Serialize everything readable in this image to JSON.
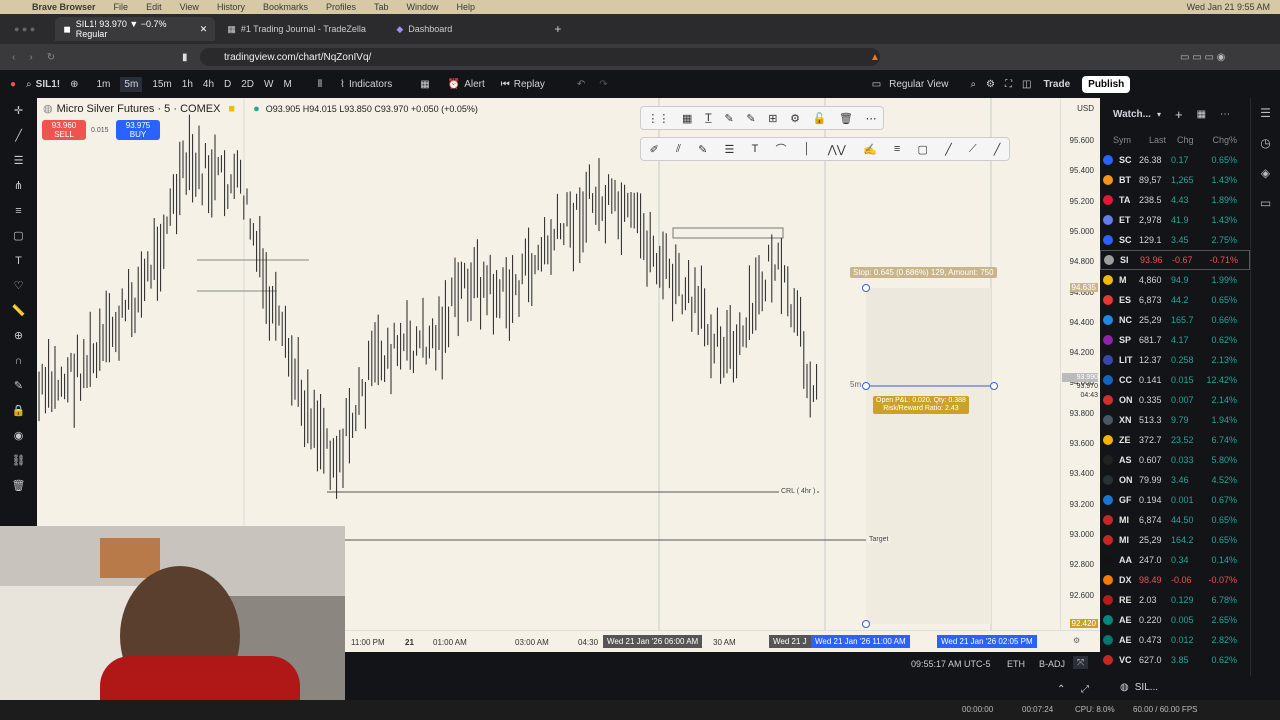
{
  "os_menu": {
    "app": "Brave Browser",
    "items": [
      "File",
      "Edit",
      "View",
      "History",
      "Bookmarks",
      "Profiles",
      "Tab",
      "Window",
      "Help"
    ],
    "clock": "Wed Jan 21  9:55 AM"
  },
  "browser_tabs": [
    {
      "label": "SIL1! 93.970 ▼ −0.7% Regular"
    },
    {
      "label": "#1 Trading Journal - TradeZella"
    },
    {
      "label": "Dashboard"
    }
  ],
  "url": "tradingview.com/chart/NqZonIVq/",
  "toolbar": {
    "symbol": "SIL1!",
    "intervals": [
      "1m",
      "5m",
      "15m",
      "1h",
      "4h",
      "D",
      "2D",
      "W",
      "M"
    ],
    "indicators": "Indicators",
    "alert": "Alert",
    "replay": "Replay",
    "session": "Regular View",
    "trade": "Trade",
    "publish": "Publish"
  },
  "legend": {
    "title": "Micro Silver Futures · 5 · COMEX",
    "ohlc": "O93.905 H94.015 L93.850 C93.970 +0.050 (+0.05%)",
    "sell_price": "93.960",
    "sell_label": "SELL",
    "spread": "0.015",
    "buy_price": "93.975",
    "buy_label": "BUY"
  },
  "price_axis": {
    "currency": "USD",
    "ticks": [
      "95.600",
      "95.400",
      "95.200",
      "95.000",
      "94.800",
      "94.600",
      "94.400",
      "94.200",
      "94.000",
      "93.800",
      "93.600",
      "93.400",
      "93.200",
      "93.000",
      "92.800",
      "92.600"
    ],
    "stop_tag": "94.635",
    "current_tag": "93.990",
    "current_time": "04:43",
    "current_last": "93.970",
    "target_tag": "92.420"
  },
  "time_axis": {
    "labels": [
      "11:00 PM",
      "21",
      "01:00 AM",
      "03:00 AM",
      "04:30",
      "30 AM"
    ],
    "highlight1": "Wed 21 Jan '26  06:00 AM",
    "highlight2": "Wed 21 Jan '26   11:00 AM",
    "highlight3": "Wed 21 Jan '26   02:05 PM",
    "partial": "Wed 21 J"
  },
  "annotations": {
    "stop": "Stop: 0.645 (0.686%) 129, Amount: 750",
    "pnl_line1": "Open P&L: 0.020, Qty: 0.388",
    "pnl_line2": "Risk/Reward Ratio: 2.43",
    "crl": "CRL ( 4hr )",
    "target": "Target",
    "five": "5m"
  },
  "status": {
    "time": "09:55:17 AM UTC-5",
    "session": "ETH",
    "adj": "B-ADJ"
  },
  "watchlist": {
    "title": "Watch...",
    "headers": [
      "Sym",
      "Last",
      "Chg",
      "Chg%"
    ],
    "rows": [
      {
        "sym": "SC",
        "last": "26.38",
        "chg": "0.17",
        "chgp": "0.65%",
        "color": "#2962ff",
        "neg": false
      },
      {
        "sym": "BT",
        "last": "89,57",
        "chg": "1,265",
        "chgp": "1.43%",
        "color": "#f7931a",
        "neg": false
      },
      {
        "sym": "TA",
        "last": "238.5",
        "chg": "4.43",
        "chgp": "1.89%",
        "color": "#e31937",
        "neg": false
      },
      {
        "sym": "ET",
        "last": "2,978",
        "chg": "41.9",
        "chgp": "1.43%",
        "color": "#627eea",
        "neg": false
      },
      {
        "sym": "SC",
        "last": "129.1",
        "chg": "3.45",
        "chgp": "2.75%",
        "color": "#2962ff",
        "neg": false
      },
      {
        "sym": "SI",
        "last": "93.96",
        "chg": "-0.67",
        "chgp": "-0.71%",
        "color": "#9e9e9e",
        "neg": true
      },
      {
        "sym": "M",
        "last": "4,860",
        "chg": "94.9",
        "chgp": "1.99%",
        "color": "#f0b90b",
        "neg": false
      },
      {
        "sym": "ES",
        "last": "6,873",
        "chg": "44.2",
        "chgp": "0.65%",
        "color": "#e53935",
        "neg": false
      },
      {
        "sym": "NC",
        "last": "25,29",
        "chg": "165.7",
        "chgp": "0.66%",
        "color": "#1e88e5",
        "neg": false
      },
      {
        "sym": "SP",
        "last": "681.7",
        "chg": "4.17",
        "chgp": "0.62%",
        "color": "#8e24aa",
        "neg": false
      },
      {
        "sym": "LIT",
        "last": "12.37",
        "chg": "0.258",
        "chgp": "2.13%",
        "color": "#3949ab",
        "neg": false
      },
      {
        "sym": "CC",
        "last": "0.141",
        "chg": "0.015",
        "chgp": "12.42%",
        "color": "#1565c0",
        "neg": false
      },
      {
        "sym": "ON",
        "last": "0.335",
        "chg": "0.007",
        "chgp": "2.14%",
        "color": "#d32f2f",
        "neg": false
      },
      {
        "sym": "XN",
        "last": "513.3",
        "chg": "9.79",
        "chgp": "1.94%",
        "color": "#455a64",
        "neg": false
      },
      {
        "sym": "ZE",
        "last": "372.7",
        "chg": "23.52",
        "chgp": "6.74%",
        "color": "#f4b400",
        "neg": false
      },
      {
        "sym": "AS",
        "last": "0.607",
        "chg": "0.033",
        "chgp": "5.80%",
        "color": "#212121",
        "neg": false
      },
      {
        "sym": "ON",
        "last": "79.99",
        "chg": "3.46",
        "chgp": "4.52%",
        "color": "#263238",
        "neg": false
      },
      {
        "sym": "GF",
        "last": "0.194",
        "chg": "0.001",
        "chgp": "0.67%",
        "color": "#1976d2",
        "neg": false
      },
      {
        "sym": "MI",
        "last": "6,874",
        "chg": "44.50",
        "chgp": "0.65%",
        "color": "#c62828",
        "neg": false
      },
      {
        "sym": "MI",
        "last": "25,29",
        "chg": "164.2",
        "chgp": "0.65%",
        "color": "#c62828",
        "neg": false
      },
      {
        "sym": "AA",
        "last": "247.0",
        "chg": "0.34",
        "chgp": "0.14%",
        "color": "#111",
        "neg": false
      },
      {
        "sym": "DX",
        "last": "98.49",
        "chg": "-0.06",
        "chgp": "-0.07%",
        "color": "#f57c00",
        "neg": true
      },
      {
        "sym": "RE",
        "last": "2.03",
        "chg": "0.129",
        "chgp": "6.78%",
        "color": "#b71c1c",
        "neg": false
      },
      {
        "sym": "AE",
        "last": "0.220",
        "chg": "0.005",
        "chgp": "2.65%",
        "color": "#00897b",
        "neg": false
      },
      {
        "sym": "AE",
        "last": "0.473",
        "chg": "0.012",
        "chgp": "2.82%",
        "color": "#00796b",
        "neg": false
      },
      {
        "sym": "VC",
        "last": "627.0",
        "chg": "3.85",
        "chgp": "0.62%",
        "color": "#c62828",
        "neg": false
      }
    ],
    "footer": "SIL..."
  },
  "os_bottom": {
    "rec_time": "00:07:24",
    "cpu": "CPU: 8.0%",
    "fps": "60.00 / 60.00 FPS",
    "tc": "00:00:00"
  }
}
